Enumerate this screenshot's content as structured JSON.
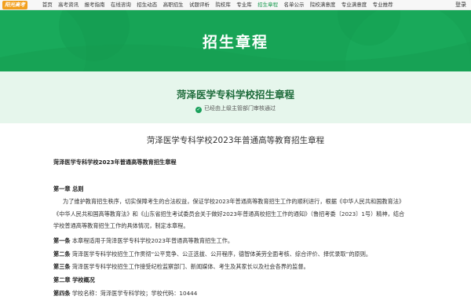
{
  "topnav": {
    "logo": "阳光高考",
    "items": [
      "首页",
      "高考资讯",
      "报考指南",
      "在线咨询",
      "招生动态",
      "高职招生",
      "试题评析",
      "院校库",
      "专业库",
      "招生章程",
      "名单公示",
      "院校满意度",
      "专业满意度",
      "专业推荐"
    ],
    "active_index": 9,
    "login": "登录"
  },
  "banner": {
    "title": "招生章程"
  },
  "header": {
    "school_title": "菏泽医学专科学校招生章程",
    "verified_text": "已经由上级主管部门审核通过"
  },
  "document": {
    "title": "菏泽医学专科学校2023年普通高等教育招生章程",
    "subtitle": "菏泽医学专科学校2023年普通高等教育招生章程",
    "chapter1": "第一章 总则",
    "para1_line1": "为了维护教育招生秩序，切实保障考生的合法权益，保证学校2023年普通高等教育招生工作的顺利进行，根据《中华人民共和国教育法》",
    "para1_line2": "《中华人民共和国高等教育法》和《山东省招生考试委员会关于做好2023年普通高校招生工作的通知》（鲁招考委〔2023〕1号）精神，结合",
    "para1_line3": "学校普通高等教育招生工作的具体情况，制定本章程。",
    "art1_label": "第一条",
    "art1_text": " 本章程适用于菏泽医学专科学校2023年普通高等教育招生工作。",
    "art2_label": "第二条",
    "art2_text": " 菏泽医学专科学校招生工作贯彻“公平竞争、公正选拔、公开程序，德智体美劳全面考核、综合评价、择优录取”的原则。",
    "art3_label": "第三条",
    "art3_text": " 菏泽医学专科学校招生工作接受纪检监察部门、新闻媒体、考生及其家长以及社会各界的监督。",
    "chapter2": "第二章 学校概况",
    "art4_label": "第四条",
    "art4_text": " 学校名称：菏泽医学专科学校；学校代码：10444"
  }
}
